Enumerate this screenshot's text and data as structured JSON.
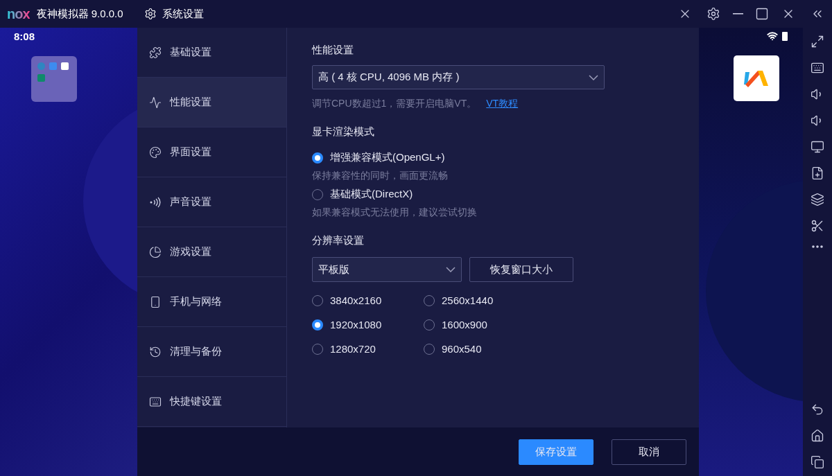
{
  "app": {
    "logo": "nox",
    "title": "夜神模拟器 9.0.0.0"
  },
  "phone": {
    "time": "8:08"
  },
  "dialog": {
    "title": "系统设置",
    "sidebar": [
      {
        "label": "基础设置",
        "selected": false
      },
      {
        "label": "性能设置",
        "selected": true
      },
      {
        "label": "界面设置",
        "selected": false
      },
      {
        "label": "声音设置",
        "selected": false
      },
      {
        "label": "游戏设置",
        "selected": false
      },
      {
        "label": "手机与网络",
        "selected": false
      },
      {
        "label": "清理与备份",
        "selected": false
      },
      {
        "label": "快捷键设置",
        "selected": false
      }
    ],
    "performance": {
      "heading": "性能设置",
      "select": "高 ( 4 核 CPU, 4096 MB 内存 )",
      "hint": "调节CPU数超过1，需要开启电脑VT。",
      "link": "VT教程"
    },
    "render": {
      "heading": "显卡渲染模式",
      "options": [
        {
          "label": "增强兼容模式(OpenGL+)",
          "description": "保持兼容性的同时，画面更流畅",
          "selected": true
        },
        {
          "label": "基础模式(DirectX)",
          "description": "如果兼容模式无法使用，建议尝试切换",
          "selected": false
        }
      ]
    },
    "resolution": {
      "heading": "分辨率设置",
      "select": "平板版",
      "button": "恢复窗口大小",
      "options": [
        {
          "label": "3840x2160",
          "selected": false
        },
        {
          "label": "2560x1440",
          "selected": false
        },
        {
          "label": "1920x1080",
          "selected": true
        },
        {
          "label": "1600x900",
          "selected": false
        },
        {
          "label": "1280x720",
          "selected": false
        },
        {
          "label": "960x540",
          "selected": false
        }
      ]
    },
    "buttons": [
      {
        "label": "保存设置",
        "kind": "primary"
      },
      {
        "label": "取消",
        "kind": "secondary"
      }
    ]
  }
}
